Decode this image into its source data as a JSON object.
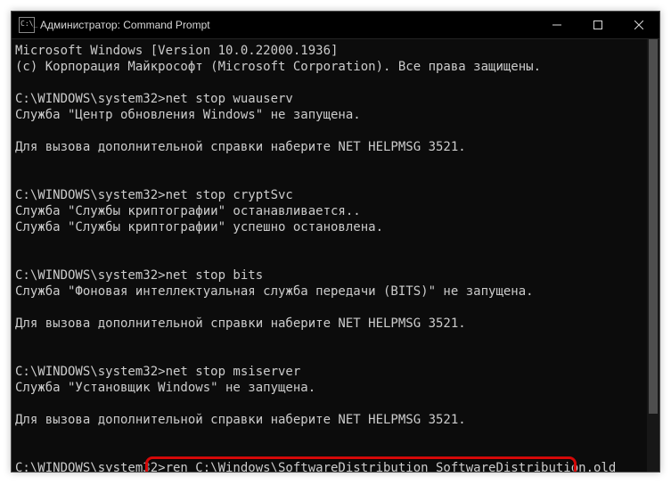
{
  "title": "Администратор: Command Prompt",
  "icon": "cmd-icon",
  "buttons": {
    "min": "—",
    "max": "◻",
    "close": "✕"
  },
  "console_lines": [
    "Microsoft Windows [Version 10.0.22000.1936]",
    "(c) Корпорация Майкрософт (Microsoft Corporation). Все права защищены.",
    "",
    "C:\\WINDOWS\\system32>net stop wuauserv",
    "Служба \"Центр обновления Windows\" не запущена.",
    "",
    "Для вызова дополнительной справки наберите NET HELPMSG 3521.",
    "",
    "",
    "C:\\WINDOWS\\system32>net stop cryptSvc",
    "Служба \"Службы криптографии\" останавливается..",
    "Служба \"Службы криптографии\" успешно остановлена.",
    "",
    "",
    "C:\\WINDOWS\\system32>net stop bits",
    "Служба \"Фоновая интеллектуальная служба передачи (BITS)\" не запущена.",
    "",
    "Для вызова дополнительной справки наберите NET HELPMSG 3521.",
    "",
    "",
    "C:\\WINDOWS\\system32>net stop msiserver",
    "Служба \"Установщик Windows\" не запущена.",
    "",
    "Для вызова дополнительной справки наберите NET HELPMSG 3521.",
    "",
    "",
    "C:\\WINDOWS\\system32>ren C:\\Windows\\SoftwareDistribution SoftwareDistribution.old"
  ],
  "highlight": {
    "line_index": 26,
    "prompt_prefix": "C:\\WINDOWS\\system32>",
    "command": "ren C:\\Windows\\SoftwareDistribution SoftwareDistribution.old"
  }
}
